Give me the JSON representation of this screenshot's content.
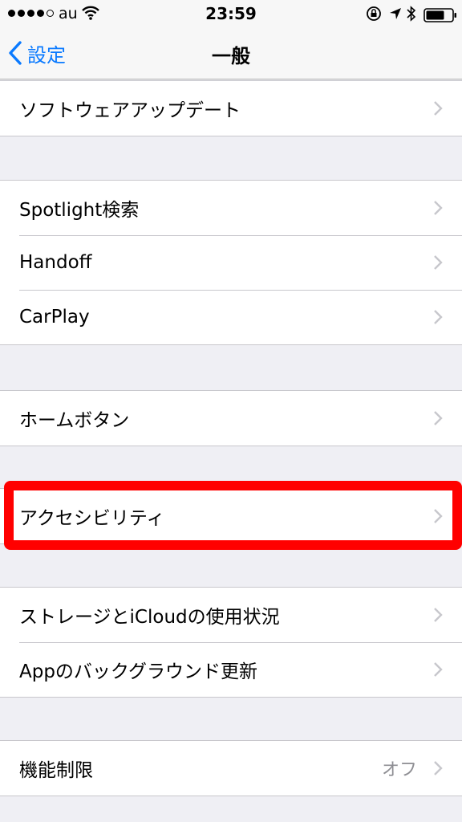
{
  "status_bar": {
    "carrier": "au",
    "time": "23:59"
  },
  "nav": {
    "back_label": "設定",
    "title": "一般"
  },
  "groups": [
    [
      {
        "label": "ソフトウェアアップデート",
        "value": ""
      }
    ],
    [
      {
        "label": "Spotlight検索",
        "value": ""
      },
      {
        "label": "Handoff",
        "value": ""
      },
      {
        "label": "CarPlay",
        "value": ""
      }
    ],
    [
      {
        "label": "ホームボタン",
        "value": ""
      }
    ],
    [
      {
        "label": "アクセシビリティ",
        "value": ""
      }
    ],
    [
      {
        "label": "ストレージとiCloudの使用状況",
        "value": ""
      },
      {
        "label": "Appのバックグラウンド更新",
        "value": ""
      }
    ],
    [
      {
        "label": "機能制限",
        "value": "オフ"
      }
    ]
  ],
  "colors": {
    "accent": "#0a7aff",
    "highlight": "#ff0000",
    "background": "#efeff4"
  }
}
